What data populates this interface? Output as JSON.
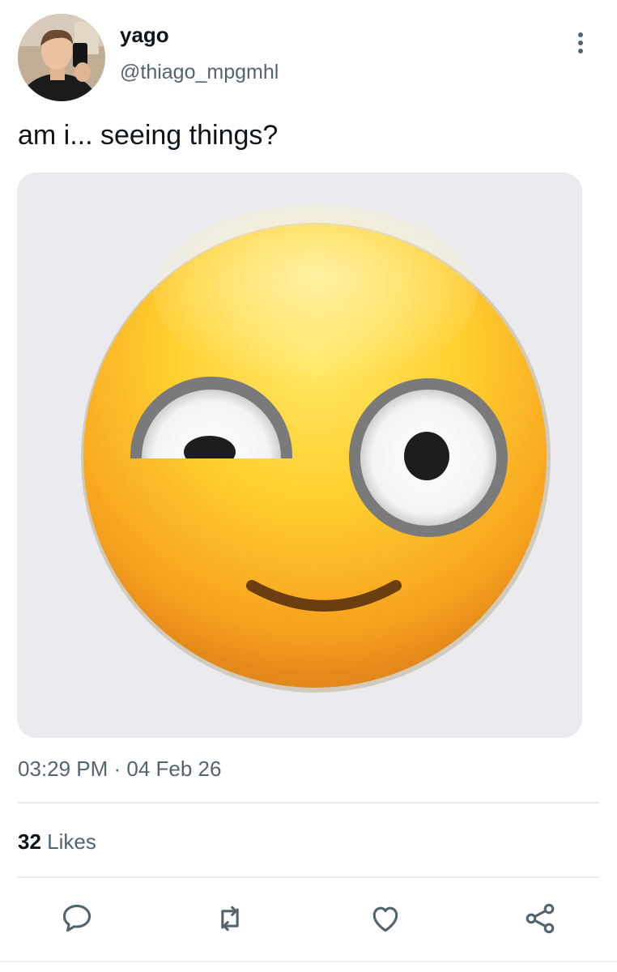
{
  "author": {
    "display_name": "yago",
    "handle": "@thiago_mpgmhl",
    "avatar": "profile-photo"
  },
  "tweet": {
    "text": "am i... seeing things?",
    "media": "flushed-face-emoji-image",
    "timestamp": "03:29 PM · 04 Feb 26"
  },
  "stats": {
    "likes_count": "32",
    "likes_label": "Likes"
  },
  "actions": {
    "reply_icon": "speech-bubble-icon",
    "retweet_icon": "retweet-arrows-icon",
    "like_icon": "heart-icon",
    "share_icon": "share-nodes-icon",
    "more_icon": "vertical-ellipsis-icon"
  },
  "colors": {
    "text_primary": "#0f1419",
    "text_secondary": "#536471",
    "divider": "#e6e9eb",
    "emoji_yellow": "#ffc928",
    "media_background": "#eaeaef"
  }
}
